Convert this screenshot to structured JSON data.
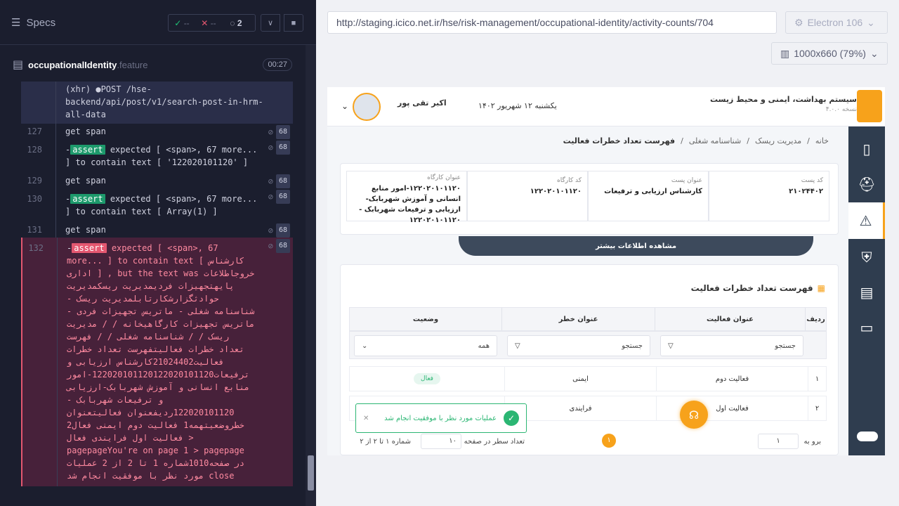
{
  "reporter": {
    "specs_label": "Specs",
    "stats": {
      "passed": "--",
      "failed": "--",
      "pending": "2"
    },
    "file": {
      "name": "occupationalIdentity",
      "ext": ".feature",
      "duration": "00:27"
    }
  },
  "commands": [
    {
      "kind": "xhr",
      "text": "(xhr)  ●POST /hse-backend/api/post/v1/search-post-in-hrm-all-data"
    },
    {
      "num": "127",
      "kind": "get",
      "text": "get  span",
      "count": "68"
    },
    {
      "num": "128",
      "kind": "assert",
      "text": "expected  [ <span>, 67 more... ]  to contain text  [ '122020101120' ]",
      "count": "68"
    },
    {
      "num": "129",
      "kind": "get",
      "text": "get  span",
      "count": "68"
    },
    {
      "num": "130",
      "kind": "assert",
      "text": "expected  [ <span>, 67 more... ]  to contain text  [ Array(1) ]",
      "count": "68"
    },
    {
      "num": "131",
      "kind": "get",
      "text": "get  span",
      "count": "68"
    },
    {
      "num": "132",
      "kind": "fail",
      "text": "expected  [ <span>, 67 more... ]  to contain text  [ کارشناس اداری ] , but the text was  خروجاطلاعات پایهتجهیزات فردیمدیریت ریسکمدیریت حوادثگزارشکارتابلمدیریت ریسک - شناسنامه شغلی - ماتریس تجهیزات فردی - ماتریس تجهیزات کارگاهیخانه / / مدیریت ریسک / / شناسنامه شغلی / / فهرست تعداد خطرات فعالیتفهرست تعداد خطرات فعالیت21024402کارشناس ارزیابی و ترفیعات122020101120122020101120-امور منابع انسانی و آموزش شهربابک-ارزیابی و ترفیعات شهربابک - 122020101120ردیفعنوان فعالیتعنوان خطروضعیتهمه1 فعالیت دوم ایمنی فعال2 فعالیت اول فرایندی فعال > pagepageYou're on page 1 > pagepage در صفحه1010شماره 1 تا 2 از 2 عملیات مورد نظر با موفقیت انجام شد close",
      "count": "68"
    }
  ],
  "runner": {
    "url": "http://staging.icico.net.ir/hse/risk-management/occupational-identity/activity-counts/704",
    "browser": "Electron 106",
    "viewport": "1000x660  (79%)"
  },
  "app": {
    "title": "سیستم بهداشت، ایمنی و محیط زیست",
    "version": "نسخه ۴.۰.۰",
    "date": "یکشنبه ۱۲ شهریور ۱۴۰۲",
    "user": "اکبر تقی پور",
    "breadcrumbs": [
      "خانه",
      "مدیریت ریسک",
      "شناسنامه شغلی",
      "فهرست تعداد خطرات فعالیت"
    ],
    "info": [
      {
        "label": "کد پست",
        "value": "۲۱۰۲۴۴۰۲"
      },
      {
        "label": "عنوان پست",
        "value": "کارشناس ارزیابی و ترفیعات"
      },
      {
        "label": "کد کارگاه",
        "value": "۱۲۲۰۲۰۱۰۱۱۲۰"
      },
      {
        "label": "عنوان کارگاه",
        "value": "۱۲۲۰۲۰۱۰۱۱۲۰-امور منابع انسانی و آموزش شهربابک-ارزیابی و ترفیعات شهربابک - ۱۲۲۰۲۰۱۰۱۱۲۰"
      }
    ],
    "more_info": "مشاهده اطلاعات بیشتر",
    "list_title": "فهرست تعداد خطرات فعالیت",
    "table": {
      "headers": [
        "ردیف",
        "عنوان فعالیت",
        "عنوان خطر",
        "وضعیت"
      ],
      "filters": {
        "search1": "جستجو",
        "search2": "جستجو",
        "status": "همه"
      },
      "rows": [
        {
          "idx": "۱",
          "activity": "فعالیت دوم",
          "hazard": "ایمنی",
          "status": "فعال"
        },
        {
          "idx": "۲",
          "activity": "فعالیت اول",
          "hazard": "فرایندی",
          "status": ""
        }
      ]
    },
    "pager": {
      "goto_label": "برو به",
      "goto_value": "۱",
      "page": "۱",
      "rows_label": "تعداد سطر در صفحه",
      "rows_value": "۱۰",
      "range": "شماره ۱ تا ۲ از ۲"
    },
    "toast": "عملیات مورد نظر با موفقیت انجام شد"
  },
  "colors": {
    "accent": "#f7a21b",
    "sidebar": "#2f3d4f",
    "success": "#2bb673",
    "fail": "#e45770",
    "assert": "#1d9a6c"
  }
}
